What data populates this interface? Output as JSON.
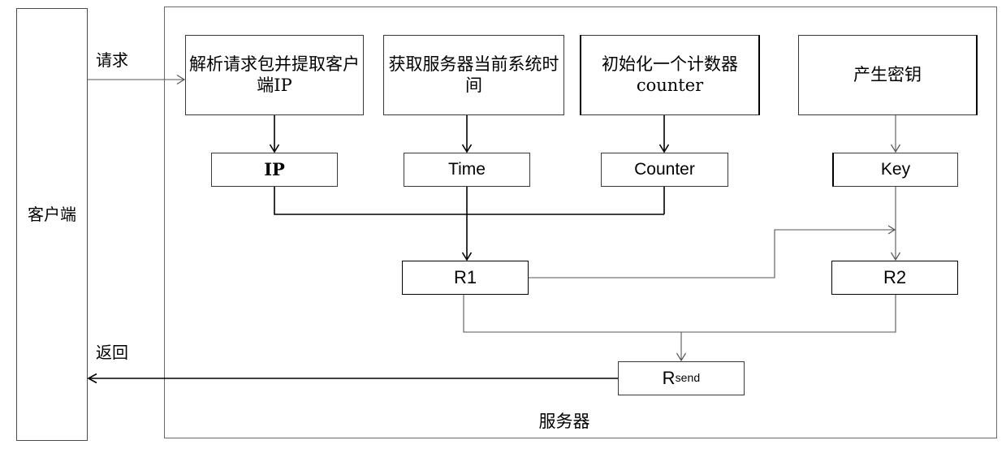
{
  "diagram": {
    "title_client": "客户端",
    "title_server": "服务器",
    "flows": {
      "request": "请求",
      "response": "返回"
    },
    "process_boxes": [
      {
        "id": "parse-request",
        "label": "解析请求包并提取客户端IP"
      },
      {
        "id": "get-server-time",
        "label": "获取服务器当前系统时间"
      },
      {
        "id": "init-counter",
        "label": "初始化一个计数器counter"
      },
      {
        "id": "generate-key",
        "label": "产生密钥"
      }
    ],
    "value_boxes": [
      {
        "id": "ip",
        "label": "IP"
      },
      {
        "id": "time",
        "label": "Time"
      },
      {
        "id": "counter",
        "label": "Counter"
      },
      {
        "id": "key",
        "label": "Key"
      }
    ],
    "result_boxes": [
      {
        "id": "r1",
        "label": "R1"
      },
      {
        "id": "r2",
        "label": "R2"
      }
    ],
    "send_box": {
      "id": "rsend",
      "label_base": "R",
      "label_sub": "send"
    },
    "colors": {
      "line": "#000000",
      "frame": "#6a6a6a",
      "background": "#ffffff",
      "text": "#000000"
    }
  }
}
